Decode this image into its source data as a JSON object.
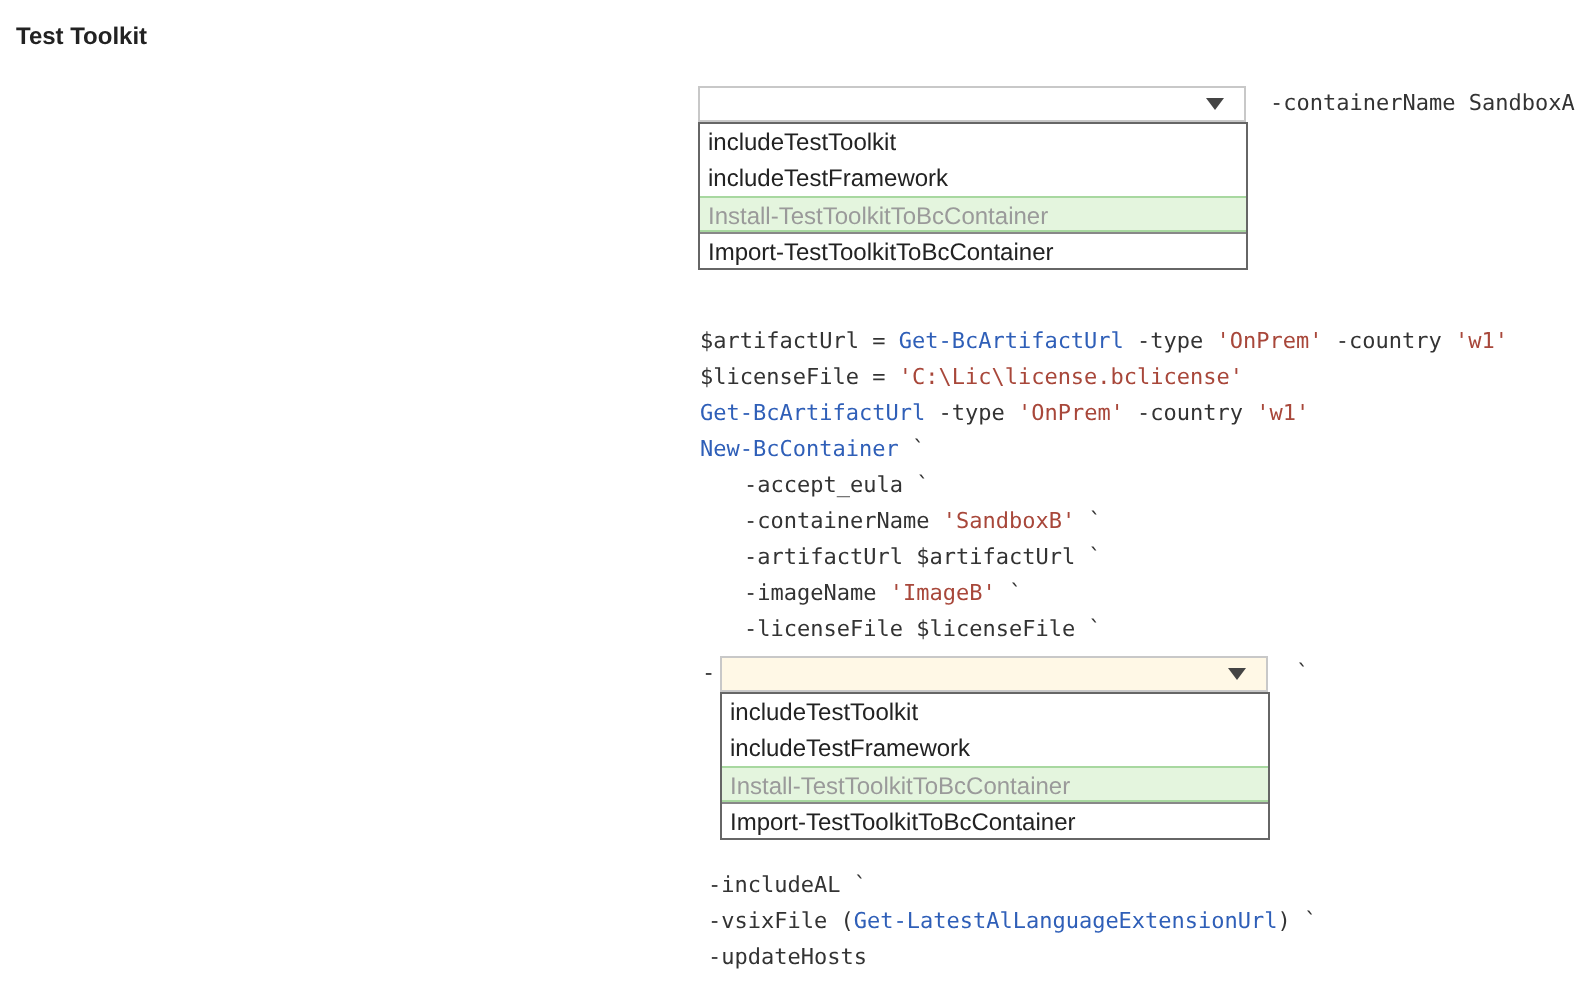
{
  "title": "Test Toolkit",
  "sections": [
    {
      "kind": "dropdown",
      "trailing": "-containerName SandboxA",
      "options": [
        {
          "label": "includeTestToolkit",
          "selected": false
        },
        {
          "label": "includeTestFramework",
          "selected": false
        },
        {
          "label": "Install-TestToolkitToBcContainer",
          "selected": true
        },
        {
          "label": "Import-TestToolkitToBcContainer",
          "selected": false
        }
      ]
    },
    {
      "kind": "code",
      "lines": [
        {
          "segments": [
            {
              "kind": "plain",
              "text": "$artifactUrl = "
            },
            {
              "kind": "cmd",
              "text": "Get-BcArtifactUrl"
            },
            {
              "kind": "plain",
              "text": " -type "
            },
            {
              "kind": "str",
              "text": "'OnPrem'"
            },
            {
              "kind": "plain",
              "text": " -country "
            },
            {
              "kind": "str",
              "text": "'w1'"
            }
          ]
        },
        {
          "segments": [
            {
              "kind": "plain",
              "text": "$licenseFile = "
            },
            {
              "kind": "str",
              "text": "'C:\\Lic\\license.bclicense'"
            }
          ]
        },
        {
          "segments": [
            {
              "kind": "cmd",
              "text": "Get-BcArtifactUrl"
            },
            {
              "kind": "plain",
              "text": " -type "
            },
            {
              "kind": "str",
              "text": "'OnPrem'"
            },
            {
              "kind": "plain",
              "text": " -country "
            },
            {
              "kind": "str",
              "text": "'w1'"
            }
          ]
        },
        {
          "segments": [
            {
              "kind": "cmd",
              "text": "New-BcContainer"
            },
            {
              "kind": "plain",
              "text": " `"
            }
          ],
          "children": [
            {
              "segments": [
                {
                  "kind": "plain",
                  "text": "-accept_eula `"
                }
              ]
            },
            {
              "segments": [
                {
                  "kind": "plain",
                  "text": "-containerName "
                },
                {
                  "kind": "str",
                  "text": "'SandboxB'"
                },
                {
                  "kind": "plain",
                  "text": " `"
                }
              ]
            },
            {
              "segments": [
                {
                  "kind": "plain",
                  "text": "-artifactUrl $artifactUrl `"
                }
              ]
            },
            {
              "segments": [
                {
                  "kind": "plain",
                  "text": "-imageName "
                },
                {
                  "kind": "str",
                  "text": "'ImageB'"
                },
                {
                  "kind": "plain",
                  "text": " `"
                }
              ]
            },
            {
              "segments": [
                {
                  "kind": "plain",
                  "text": "-licenseFile $licenseFile `"
                }
              ]
            }
          ]
        }
      ]
    },
    {
      "kind": "dropdown",
      "lead": "-",
      "trailing": "`",
      "options": [
        {
          "label": "includeTestToolkit",
          "selected": false
        },
        {
          "label": "includeTestFramework",
          "selected": false
        },
        {
          "label": "Install-TestToolkitToBcContainer",
          "selected": true
        },
        {
          "label": "Import-TestToolkitToBcContainer",
          "selected": false
        }
      ]
    },
    {
      "kind": "code",
      "lines": [
        {
          "segments": [
            {
              "kind": "plain",
              "text": "-includeAL `"
            }
          ]
        },
        {
          "segments": [
            {
              "kind": "plain",
              "text": "-vsixFile ("
            },
            {
              "kind": "cmd",
              "text": "Get-LatestAlLanguageExtensionUrl"
            },
            {
              "kind": "plain",
              "text": ") `"
            }
          ]
        },
        {
          "segments": [
            {
              "kind": "plain",
              "text": "-updateHosts"
            }
          ]
        }
      ]
    }
  ]
}
